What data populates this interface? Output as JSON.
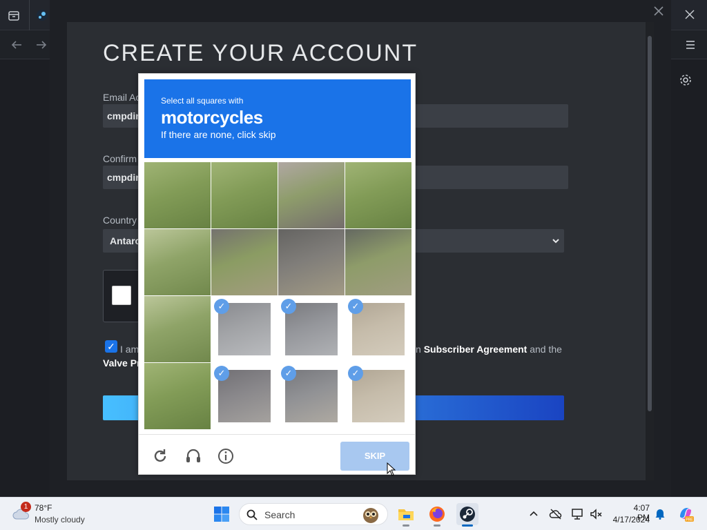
{
  "modal": {
    "title": "CREATE YOUR ACCOUNT",
    "email_label": "Email Ac",
    "email_value": "cmpdirr",
    "confirm_label": "Confirm",
    "confirm_value": "cmpdirr",
    "country_label": "Country",
    "country_value": "Antarc",
    "agree_start": "I am",
    "agree_link1": "Subscriber Agreement",
    "agree_mid": " and the",
    "agree_line2": "Valve Pr",
    "agree_prefix": "n "
  },
  "captcha": {
    "instruction_small": "Select all squares with",
    "target": "motorcycles",
    "instruction_hint": "If there are none, click skip",
    "cells": [
      {
        "selected": false,
        "image": "grass"
      },
      {
        "selected": false,
        "image": "grass"
      },
      {
        "selected": false,
        "image": "person-head"
      },
      {
        "selected": false,
        "image": "grass"
      },
      {
        "selected": false,
        "image": "grass-tall"
      },
      {
        "selected": false,
        "image": "rider-arm"
      },
      {
        "selected": false,
        "image": "rider-body"
      },
      {
        "selected": false,
        "image": "motorcycle-handle"
      },
      {
        "selected": false,
        "image": "grass-tall"
      },
      {
        "selected": true,
        "image": "motorcycle-front"
      },
      {
        "selected": true,
        "image": "motorcycle-body"
      },
      {
        "selected": true,
        "image": "dirt-road"
      },
      {
        "selected": false,
        "image": "grass"
      },
      {
        "selected": true,
        "image": "motorcycle-wheel"
      },
      {
        "selected": true,
        "image": "motorcycle-lower"
      },
      {
        "selected": true,
        "image": "dirt-road"
      }
    ],
    "skip_label": "SKIP",
    "footer_icons": [
      "refresh-icon",
      "audio-icon",
      "info-icon"
    ]
  },
  "taskbar": {
    "weather_temp": "78°F",
    "weather_cond": "Mostly cloudy",
    "weather_badge": "1",
    "search_placeholder": "Search",
    "time": "4:07 PM",
    "date": "4/17/2024",
    "apps": [
      "file-explorer",
      "firefox",
      "steam"
    ]
  },
  "colors": {
    "captcha_blue": "#1a73e8",
    "check_blue": "#5f9ee8",
    "skip_disabled": "#a8c8f0"
  }
}
